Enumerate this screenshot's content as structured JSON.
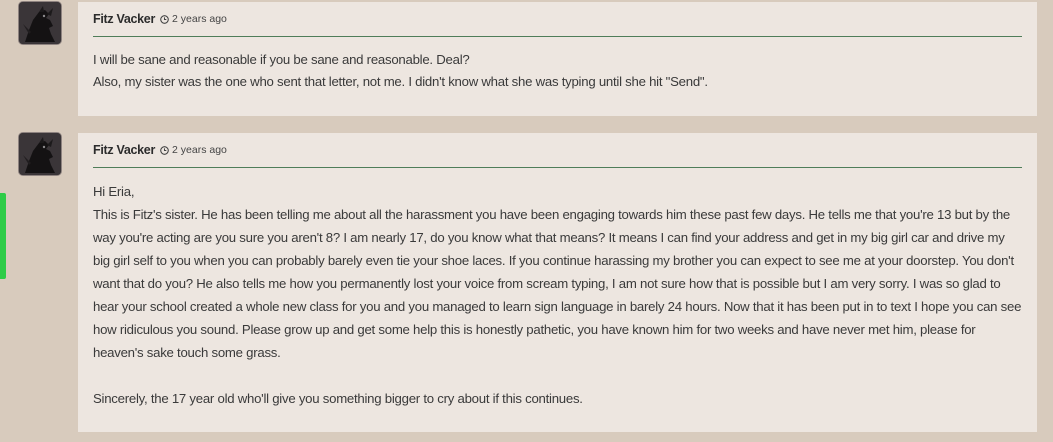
{
  "comments": [
    {
      "author": "Fitz Vacker",
      "time": "2 years ago",
      "lines": [
        "I will be sane and reasonable if you be sane and reasonable. Deal?",
        "Also, my sister was the one who sent that letter, not me. I didn't know what she was typing until she hit \"Send\"."
      ]
    },
    {
      "author": "Fitz Vacker",
      "time": "2 years ago",
      "lines": [
        "Hi Eria,",
        "This is Fitz's sister. He has been telling me about all the harassment you have been engaging towards him these past few days. He tells me that you're 13 but by the way you're acting are you sure you aren't 8? I am nearly 17, do you know what that means? It means I can find your address and get in my big girl car and drive my big girl self to you when you can probably barely even tie your shoe laces. If you continue harassing my brother you can expect to see me at your doorstep. You don't want that do you? He also tells me how you permanently lost your voice from scream typing, I am not sure how that is possible but I am very sorry. I was so glad to hear your school created a whole new class for you and you managed to learn sign language in barely 24 hours. Now that it has been put in to text I hope you can see how ridiculous you sound. Please grow up and get some help this is honestly pathetic, you have known him for two weeks and have never met him, please for heaven's sake touch some grass.",
        "",
        "Sincerely, the 17 year old who'll give you something bigger to cry about if this continues."
      ]
    }
  ],
  "icons": {
    "avatar": "dragon-avatar-icon",
    "time": "clock-icon"
  },
  "colors": {
    "page_bg": "#d8cbbd",
    "card_bg": "#ede6e0",
    "divider": "#4f7d59",
    "side_tab": "#2ecc48"
  }
}
